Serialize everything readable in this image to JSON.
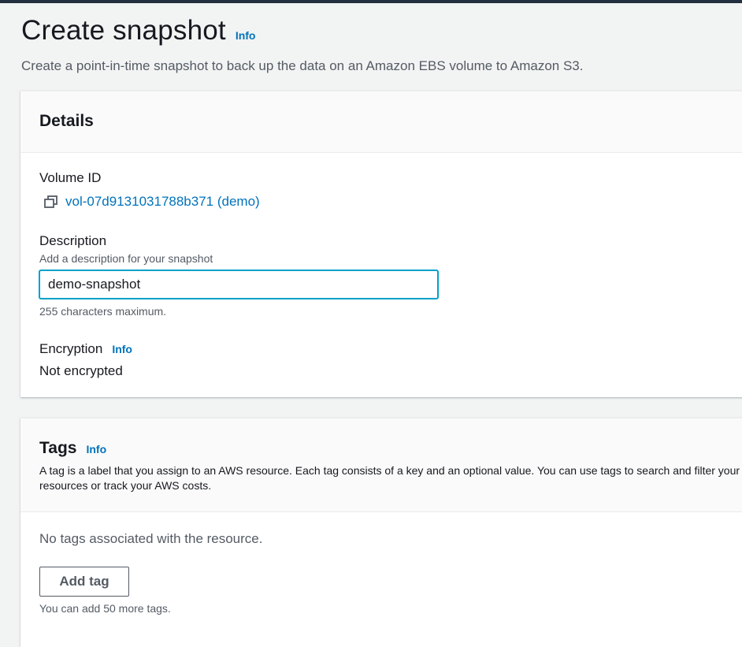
{
  "header": {
    "title": "Create snapshot",
    "info_label": "Info",
    "subtitle": "Create a point-in-time snapshot to back up the data on an Amazon EBS volume to Amazon S3."
  },
  "details": {
    "heading": "Details",
    "volume_id_label": "Volume ID",
    "volume_id_value": "vol-07d9131031788b371 (demo)",
    "volume_icon": "copy-icon",
    "description_label": "Description",
    "description_hint": "Add a description for your snapshot",
    "description_value": "demo-snapshot",
    "description_constraint": "255 characters maximum.",
    "encryption_label": "Encryption",
    "encryption_info": "Info",
    "encryption_value": "Not encrypted"
  },
  "tags": {
    "heading": "Tags",
    "info_label": "Info",
    "description": "A tag is a label that you assign to an AWS resource. Each tag consists of a key and an optional value. You can use tags to search and filter your resources or track your AWS costs.",
    "empty_text": "No tags associated with the resource.",
    "add_button_label": "Add tag",
    "remaining_hint": "You can add 50 more tags."
  },
  "colors": {
    "link": "#0073bb",
    "focus_border": "#00a1c9",
    "top_bar": "#232f3e"
  }
}
